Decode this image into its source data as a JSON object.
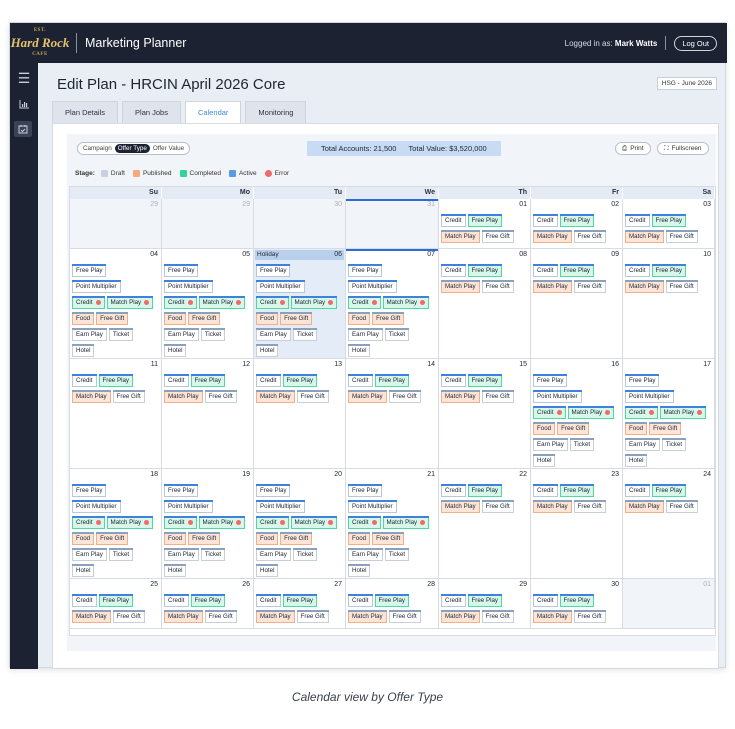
{
  "app": {
    "logo_text": "Hard Rock",
    "title": "Marketing Planner",
    "logged_in_prefix": "Logged in as:",
    "user": "Mark Watts",
    "logout": "Log Out"
  },
  "sidebar": {
    "icons": [
      "menu-icon",
      "chart-icon",
      "calendar-check-icon"
    ]
  },
  "page": {
    "title": "Edit Plan - HRCIN April 2026 Core",
    "badge": "HSG - June 2026"
  },
  "tabs": [
    "Plan Details",
    "Plan Jobs",
    "Calendar",
    "Monitoring"
  ],
  "active_tab": "Calendar",
  "toolbar": {
    "segments": [
      "Campaign",
      "Offer Type",
      "Offer Value"
    ],
    "selected_segment": "Offer Type",
    "total_accounts_label": "Total Accounts: 21,500",
    "total_value_label": "Total Value: $3,520,000",
    "print": "Print",
    "fullscreen": "Fullscreen"
  },
  "stage_legend": {
    "label": "Stage:",
    "items": [
      {
        "name": "Draft",
        "color": "#c7d0dc"
      },
      {
        "name": "Published",
        "color": "#f5a97f"
      },
      {
        "name": "Completed",
        "color": "#34d399"
      },
      {
        "name": "Active",
        "color": "#5b9be6"
      },
      {
        "name": "Error",
        "color": "#f06a6a"
      }
    ]
  },
  "weekdays": [
    "Su",
    "Mo",
    "Tu",
    "We",
    "Th",
    "Fr",
    "Sa"
  ],
  "holiday_label": "Holiday",
  "caption": "Calendar view by Offer Type",
  "weeks": [
    [
      {
        "day": "29",
        "muted": true,
        "set": "none"
      },
      {
        "day": "29",
        "muted": true,
        "set": "none"
      },
      {
        "day": "30",
        "muted": true,
        "set": "none"
      },
      {
        "day": "31",
        "muted": true,
        "set": "none",
        "today": true
      },
      {
        "day": "01",
        "set": "small"
      },
      {
        "day": "02",
        "set": "small"
      },
      {
        "day": "03",
        "set": "small"
      }
    ],
    [
      {
        "day": "04",
        "set": "big"
      },
      {
        "day": "05",
        "set": "big"
      },
      {
        "day": "06",
        "set": "big",
        "holiday": true
      },
      {
        "day": "07",
        "set": "big",
        "today": true
      },
      {
        "day": "08",
        "set": "small"
      },
      {
        "day": "09",
        "set": "small"
      },
      {
        "day": "10",
        "set": "small"
      }
    ],
    [
      {
        "day": "11",
        "set": "small"
      },
      {
        "day": "12",
        "set": "small"
      },
      {
        "day": "13",
        "set": "small"
      },
      {
        "day": "14",
        "set": "small"
      },
      {
        "day": "15",
        "set": "small"
      },
      {
        "day": "16",
        "set": "big"
      },
      {
        "day": "17",
        "set": "big"
      }
    ],
    [
      {
        "day": "18",
        "set": "big"
      },
      {
        "day": "19",
        "set": "big"
      },
      {
        "day": "20",
        "set": "big"
      },
      {
        "day": "21",
        "set": "big"
      },
      {
        "day": "22",
        "set": "small"
      },
      {
        "day": "23",
        "set": "small"
      },
      {
        "day": "24",
        "set": "small"
      }
    ],
    [
      {
        "day": "25",
        "set": "small"
      },
      {
        "day": "26",
        "set": "small"
      },
      {
        "day": "27",
        "set": "small"
      },
      {
        "day": "28",
        "set": "small"
      },
      {
        "day": "29",
        "set": "small"
      },
      {
        "day": "30",
        "set": "small"
      },
      {
        "day": "01",
        "muted": true,
        "set": "none"
      }
    ]
  ],
  "pill_sets": {
    "small": [
      [
        {
          "text": "Credit",
          "style": "d"
        },
        {
          "text": "Free Play",
          "style": "g"
        }
      ],
      [
        {
          "text": "Match Play",
          "style": "o"
        },
        {
          "text": "Free Gift",
          "style": "gr"
        }
      ]
    ],
    "big": [
      [
        {
          "text": "Free Play",
          "style": "d"
        }
      ],
      [
        {
          "text": "Point Multiplier",
          "style": "d"
        }
      ],
      [
        {
          "text": "Credit",
          "style": "g",
          "error": true
        },
        {
          "text": "Match Play",
          "style": "g",
          "error": true
        }
      ],
      [
        {
          "text": "Food",
          "style": "o"
        },
        {
          "text": "Free Gift",
          "style": "o"
        }
      ],
      [
        {
          "text": "Earn Play",
          "style": "gr"
        },
        {
          "text": "Ticket",
          "style": "gr"
        }
      ],
      [
        {
          "text": "Hotel",
          "style": "gr"
        }
      ]
    ]
  }
}
